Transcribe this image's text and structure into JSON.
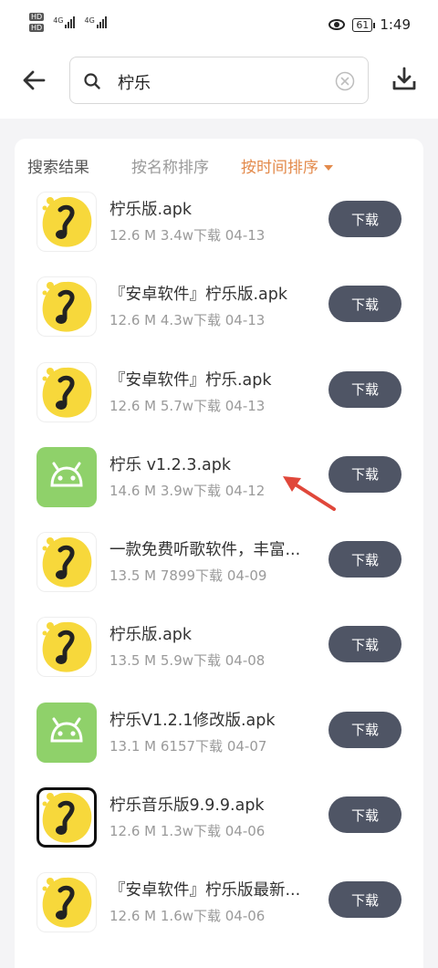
{
  "status_bar": {
    "hd1": "HD",
    "hd2": "HD",
    "net1": "4G",
    "net2": "4G",
    "battery": "61",
    "time": "1:49",
    "icons": [
      "eye-icon",
      "battery-icon",
      "signal-icon"
    ]
  },
  "header": {
    "search_value": "柠乐",
    "icons": [
      "back-arrow-icon",
      "search-icon",
      "clear-icon",
      "download-icon"
    ]
  },
  "tabs": {
    "results": "搜索结果",
    "by_name": "按名称排序",
    "by_time": "按时间排序",
    "active": "by_time"
  },
  "items": [
    {
      "title": "柠乐版.apk",
      "meta": "12.6 M  3.4w下载  04-13",
      "button": "下载",
      "icon": "lemon-music-icon"
    },
    {
      "title": "『安卓软件』柠乐版.apk",
      "meta": "12.6 M  4.3w下载  04-13",
      "button": "下载",
      "icon": "lemon-music-icon"
    },
    {
      "title": "『安卓软件』柠乐.apk",
      "meta": "12.6 M  5.7w下载  04-13",
      "button": "下载",
      "icon": "lemon-music-icon"
    },
    {
      "title": "柠乐 v1.2.3.apk",
      "meta": "14.6 M  3.9w下载  04-12",
      "button": "下载",
      "icon": "android-icon"
    },
    {
      "title": "一款免费听歌软件，丰富...",
      "meta": "13.5 M  7899下载  04-09",
      "button": "下载",
      "icon": "lemon-music-icon"
    },
    {
      "title": "柠乐版.apk",
      "meta": "13.5 M  5.9w下载  04-08",
      "button": "下载",
      "icon": "lemon-music-icon"
    },
    {
      "title": "柠乐V1.2.1修改版.apk",
      "meta": "13.1 M  6157下载  04-07",
      "button": "下载",
      "icon": "android-icon"
    },
    {
      "title": "柠乐音乐版9.9.9.apk",
      "meta": "12.6 M  1.3w下载  04-06",
      "button": "下载",
      "icon": "lemon-music-icon"
    },
    {
      "title": "『安卓软件』柠乐版最新...",
      "meta": "12.6 M  1.6w下载  04-06",
      "button": "下载",
      "icon": "lemon-music-icon"
    }
  ],
  "colors": {
    "accent": "#e38a4b",
    "button_bg": "#4f5565",
    "android_green": "#8fd16a",
    "lemon_yellow": "#f7d83b",
    "annotation_arrow": "#e0473a"
  }
}
